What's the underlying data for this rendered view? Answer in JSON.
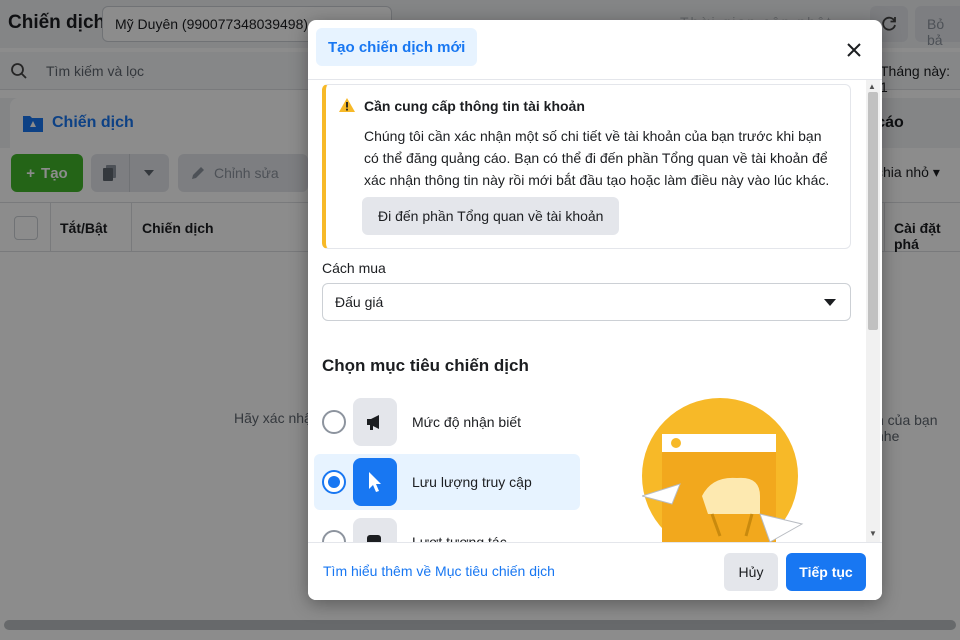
{
  "background": {
    "title": "Chiến dịch",
    "account": "Mỹ Duyên (990077348039498)",
    "top_status": "Thời gian cập nhật",
    "discard_label": "Bỏ bả",
    "search": {
      "placeholder": "Tìm kiếm và lọc"
    },
    "date_range": "Tháng này: 1",
    "tabs": {
      "campaigns": "Chiến dịch",
      "ads": "g cáo"
    },
    "toolbar": {
      "create_label": "Tạo",
      "edit_label": "Chỉnh sửa",
      "breakdown_label": "chia nhỏ"
    },
    "table": {
      "headers": [
        "Tắt/Bật",
        "Chiến dịch",
        "Cài đặt phá"
      ]
    },
    "empty_left": "Hãy xác nhậ",
    "empty_right": "n của bạn nhe"
  },
  "modal": {
    "tab_label": "Tạo chiến dịch mới",
    "alert": {
      "title": "Cần cung cấp thông tin tài khoản",
      "text": "Chúng tôi cần xác nhận một số chi tiết về tài khoản của bạn trước khi bạn có thể đăng quảng cáo. Bạn có thể đi đến phần Tổng quan về tài khoản để xác nhận thông tin này rồi mới bắt đầu tạo hoặc làm điều này vào lúc khác.",
      "button": "Đi đến phần Tổng quan về tài khoản"
    },
    "buying": {
      "label": "Cách mua",
      "value": "Đấu giá"
    },
    "objective": {
      "title": "Chọn mục tiêu chiến dịch",
      "options": [
        {
          "label": "Mức độ nhận biết",
          "icon": "megaphone-icon",
          "selected": false
        },
        {
          "label": "Lưu lượng truy cập",
          "icon": "cursor-icon",
          "selected": true
        },
        {
          "label": "Lượt tương tác",
          "icon": "chat-icon",
          "selected": false
        }
      ]
    },
    "footer": {
      "learn_more": "Tìm hiểu thêm về Mục tiêu chiến dịch",
      "cancel": "Hủy",
      "continue": "Tiếp tục"
    }
  },
  "colors": {
    "accent": "#1877f2",
    "create": "#42b72a",
    "warning": "#f7b928",
    "illustration": "#f7b928"
  }
}
